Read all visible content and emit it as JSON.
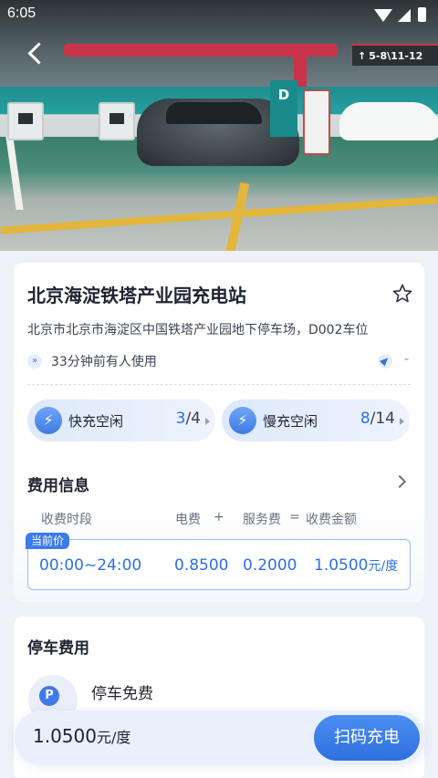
{
  "status_bar": {
    "time": "6:05"
  },
  "hero": {
    "sign_text": "5-8\\11-12",
    "pillar_letter": "D"
  },
  "station": {
    "name": "北京海淀铁塔产业园充电站",
    "address": "北京市北京市海淀区中国铁塔产业园地下停车场，D002车位",
    "usage": "33分钟前有人使用",
    "distance": "-",
    "fast": {
      "label": "快充空闲",
      "available": "3",
      "total": "/4"
    },
    "slow": {
      "label": "慢充空闲",
      "available": "8",
      "total": "/14"
    }
  },
  "fee": {
    "title": "费用信息",
    "headers": {
      "period": "收费时段",
      "electric": "电费",
      "plus": "+",
      "service": "服务费",
      "equals": "=",
      "amount": "收费金额"
    },
    "current_tag": "当前价",
    "row": {
      "period": "00:00~24:00",
      "electric": "0.8500",
      "service": "0.2000",
      "amount": "1.0500",
      "unit": "元/度"
    }
  },
  "parking": {
    "title": "停车费用",
    "label": "停车免费",
    "icon": "P"
  },
  "bottom": {
    "price": "1.0500",
    "unit": "元/度",
    "scan_button": "扫码充电"
  },
  "colors": {
    "accent": "#2e6fe3",
    "button": "#3f7ae6"
  }
}
